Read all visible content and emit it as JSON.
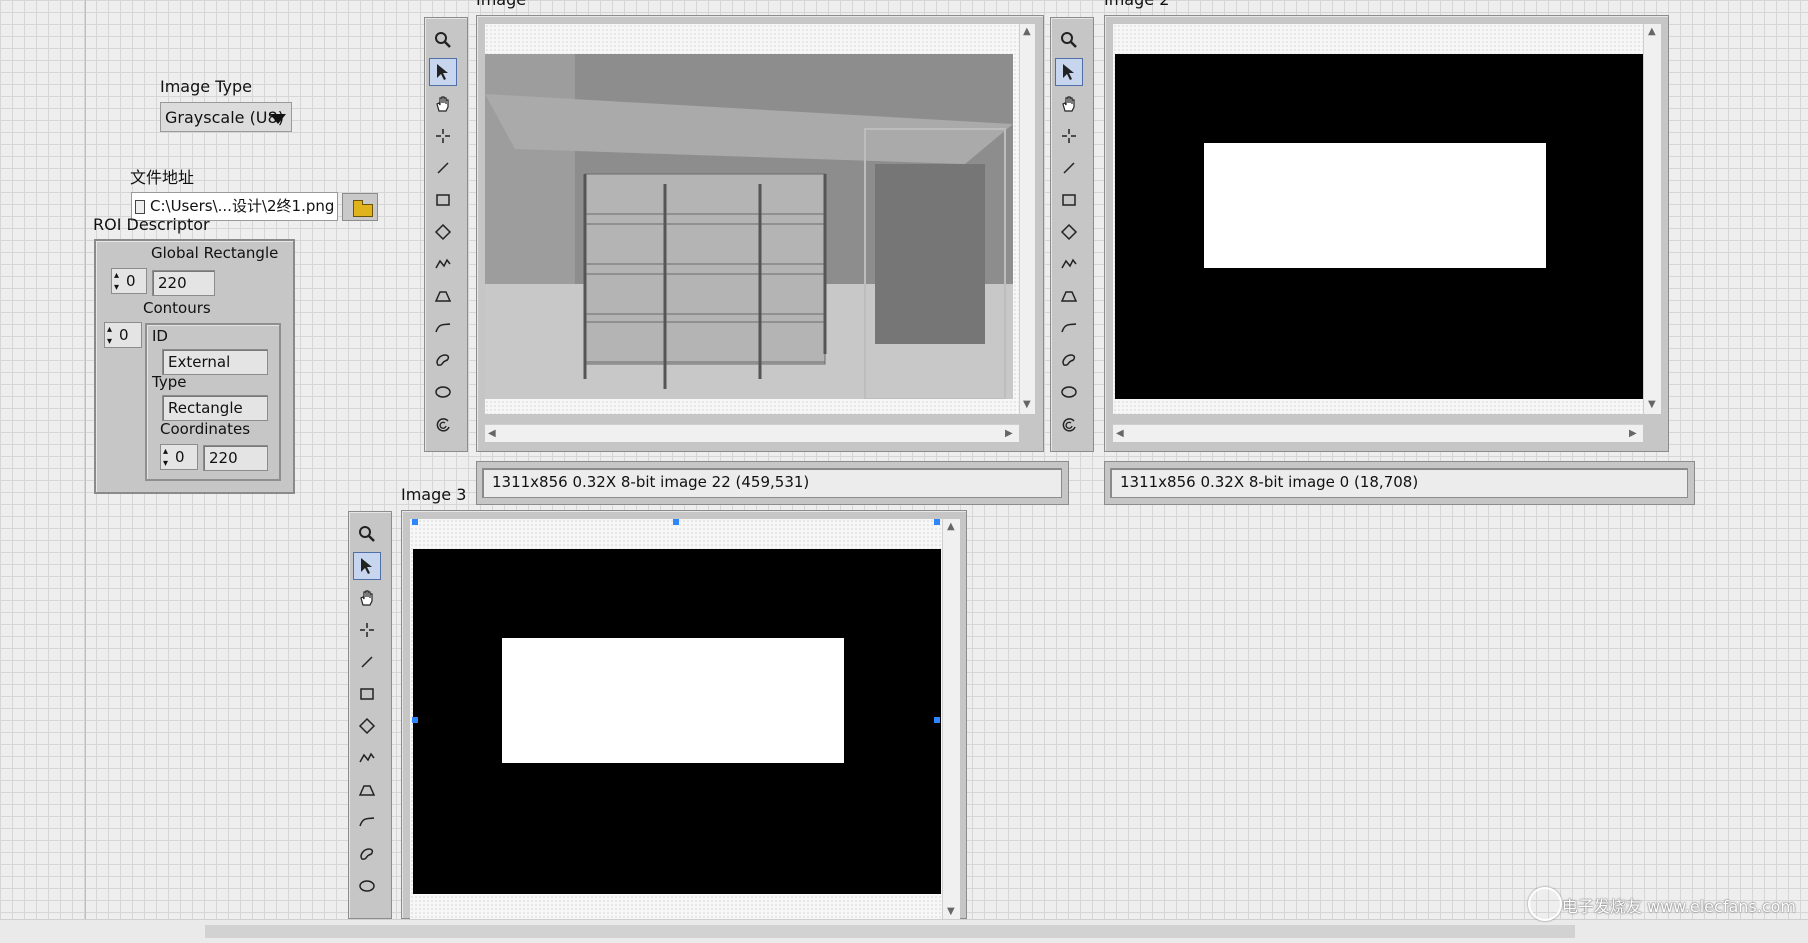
{
  "image_type": {
    "label": "Image Type",
    "value": "Grayscale (U8)"
  },
  "file_path": {
    "label": "文件地址",
    "value": "C:\\Users\\...设计\\2终1.png"
  },
  "roi": {
    "label": "ROI Descriptor",
    "global_rect_label": "Global Rectangle",
    "global_rect_index": "0",
    "global_rect_value": "220",
    "contours_label": "Contours",
    "contours_index": "0",
    "id_label": "ID",
    "id_value": "External",
    "type_label": "Type",
    "type_value": "Rectangle",
    "coords_label": "Coordinates",
    "coords_index": "0",
    "coords_value": "220"
  },
  "displays": [
    {
      "label": "Image",
      "status": "1311x856 0.32X 8-bit image 22    (459,531)"
    },
    {
      "label": "Image 2",
      "status": "1311x856 0.32X 8-bit image 0    (18,708)"
    },
    {
      "label": "Image 3"
    }
  ],
  "tools": [
    "zoom-tool",
    "pointer-tool",
    "pan-tool",
    "point-tool",
    "line-tool",
    "rectangle-tool",
    "rotated-rectangle-tool",
    "polyline-tool",
    "polygon-tool",
    "freehand-line-tool",
    "freehand-region-tool",
    "oval-tool",
    "annulus-tool"
  ],
  "watermark": "电子发烧友 www.elecfans.com"
}
